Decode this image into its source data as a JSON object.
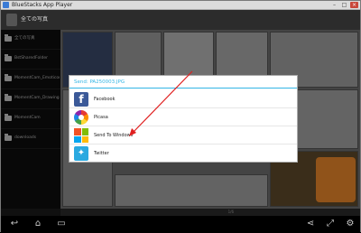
{
  "window": {
    "title": "BlueStacks App Player",
    "min_label": "–",
    "max_label": "□",
    "close_label": "×"
  },
  "actionbar": {
    "title": "全ての写真"
  },
  "sidebar": {
    "items": [
      {
        "label": "全ての写真"
      },
      {
        "label": "BstSharedFolder"
      },
      {
        "label": "MomentCam_Emoticon"
      },
      {
        "label": "MomentCam_Drawing"
      },
      {
        "label": "MomentCam"
      },
      {
        "label": "downloads"
      }
    ]
  },
  "gallery": {
    "counter": "1/6"
  },
  "dialog": {
    "title": "Send: PA250003.JPG",
    "options": [
      {
        "label": "Facebook",
        "icon": "facebook-icon"
      },
      {
        "label": "Picasa",
        "icon": "picasa-icon"
      },
      {
        "label": "Send To Windows",
        "icon": "windows-icon"
      },
      {
        "label": "Twitter",
        "icon": "twitter-icon"
      }
    ]
  },
  "navbar": {
    "back": "back-icon",
    "home": "home-icon",
    "recents": "recents-icon",
    "share": "share-icon",
    "fullscreen": "fullscreen-icon",
    "settings": "settings-icon"
  },
  "colors": {
    "accent": "#33b5e5",
    "facebook": "#3b5998",
    "twitter": "#2aa9e0",
    "annotation_arrow": "#e02020",
    "windows": [
      "#f35325",
      "#81bc06",
      "#05a6f0",
      "#ffba08"
    ]
  }
}
